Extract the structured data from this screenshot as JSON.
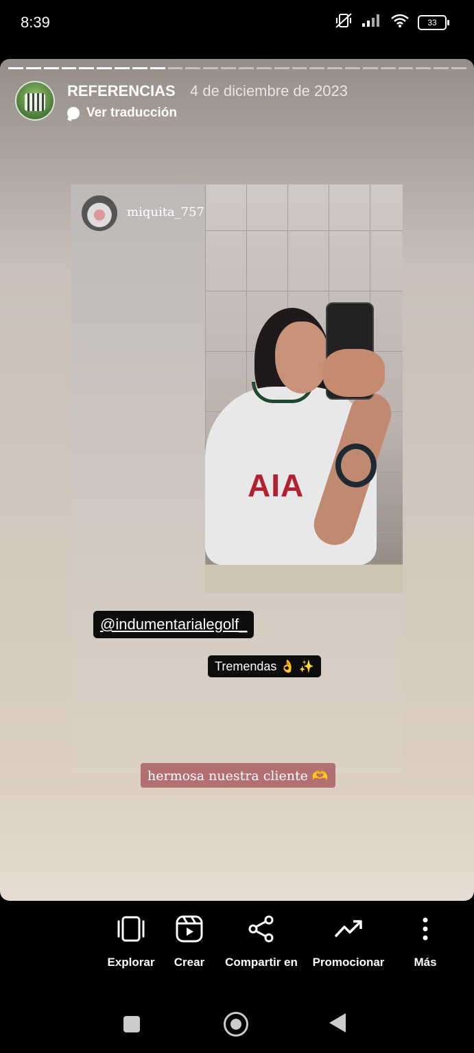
{
  "status_bar": {
    "time": "8:39",
    "battery": "33"
  },
  "story": {
    "progress": {
      "segments": 26,
      "completed": 9
    },
    "account_name": "REFERENCIAS",
    "date": "4 de diciembre de 2023",
    "translate_label": "Ver traducción",
    "repost": {
      "username": "miquita_757",
      "shirt_text": "AIA",
      "mention_sticker": "@indumentarialegolf_",
      "text_sticker": "Tremendas 👌 ✨"
    },
    "caption": "hermosa nuestra cliente 🫶"
  },
  "actions": [
    {
      "label": "Explorar",
      "icon": "explore-icon"
    },
    {
      "label": "Crear",
      "icon": "reels-icon"
    },
    {
      "label": "Compartir en",
      "icon": "share-icon"
    },
    {
      "label": "Promocionar",
      "icon": "trending-icon"
    },
    {
      "label": "Más",
      "icon": "more-vertical-icon"
    }
  ],
  "colors": {
    "caption_bg": "#b27073",
    "sticker_bg": "#0d0d0d"
  }
}
